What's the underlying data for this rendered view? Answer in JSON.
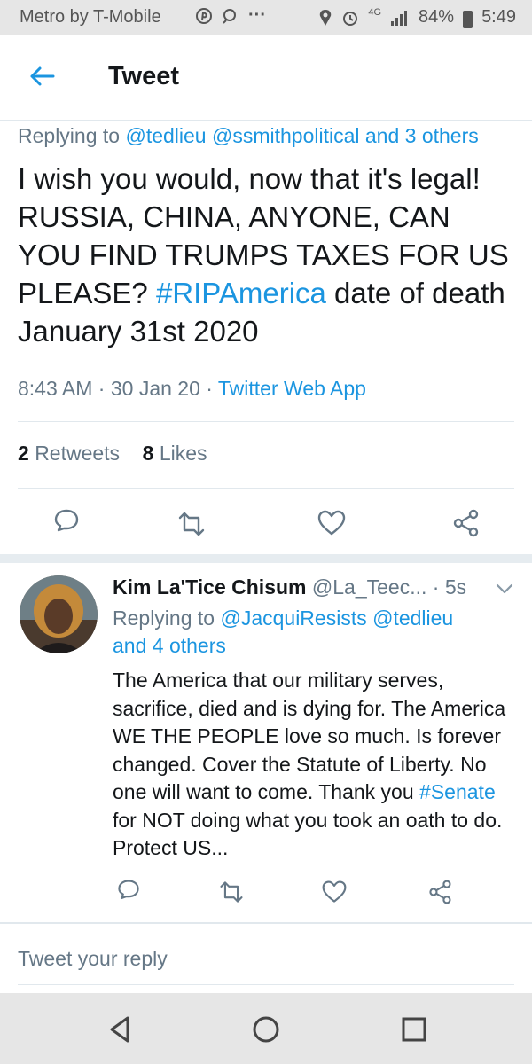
{
  "status_bar": {
    "carrier": "Metro by T-Mobile",
    "network": "4G",
    "battery": "84%",
    "time": "5:49"
  },
  "header": {
    "title": "Tweet",
    "back_icon": "arrow-left-icon"
  },
  "main_tweet": {
    "replying_prefix": "Replying to ",
    "replying_to": "@tedlieu @ssmithpolitical and 3 others",
    "text_plain": "I wish you would, now that it's legal! RUSSIA, CHINA, ANYONE, CAN YOU FIND TRUMPS TAXES FOR US PLEASE? ",
    "hashtag": "#RIPAmerica",
    "text_after": " date of death January 31st 2020",
    "time": "8:43 AM",
    "date": "30 Jan 20",
    "source": "Twitter Web App",
    "retweets_count": "2",
    "retweets_label": "Retweets",
    "likes_count": "8",
    "likes_label": "Likes"
  },
  "reply": {
    "name": "Kim La'Tice Chisum",
    "handle": "@La_Teec...",
    "time": "5s",
    "replying_prefix": "Replying to ",
    "replying_to_1": "@JacquiResists @tedlieu",
    "replying_to_2": "and 4 others",
    "text_before": "The America that our military serves, sacrifice, died and is dying for. The America WE THE PEOPLE love so much. Is forever changed. Cover the Statute of Liberty. No one will want to come. Thank you ",
    "hashtag": "#Senate",
    "text_after": " for NOT doing what you took an oath to do. Protect US..."
  },
  "reply_box": {
    "placeholder": "Tweet your reply"
  },
  "colors": {
    "accent": "#1b95e0",
    "secondary_text": "#657786",
    "primary_text": "#14171a",
    "divider": "#e1e8ed"
  }
}
